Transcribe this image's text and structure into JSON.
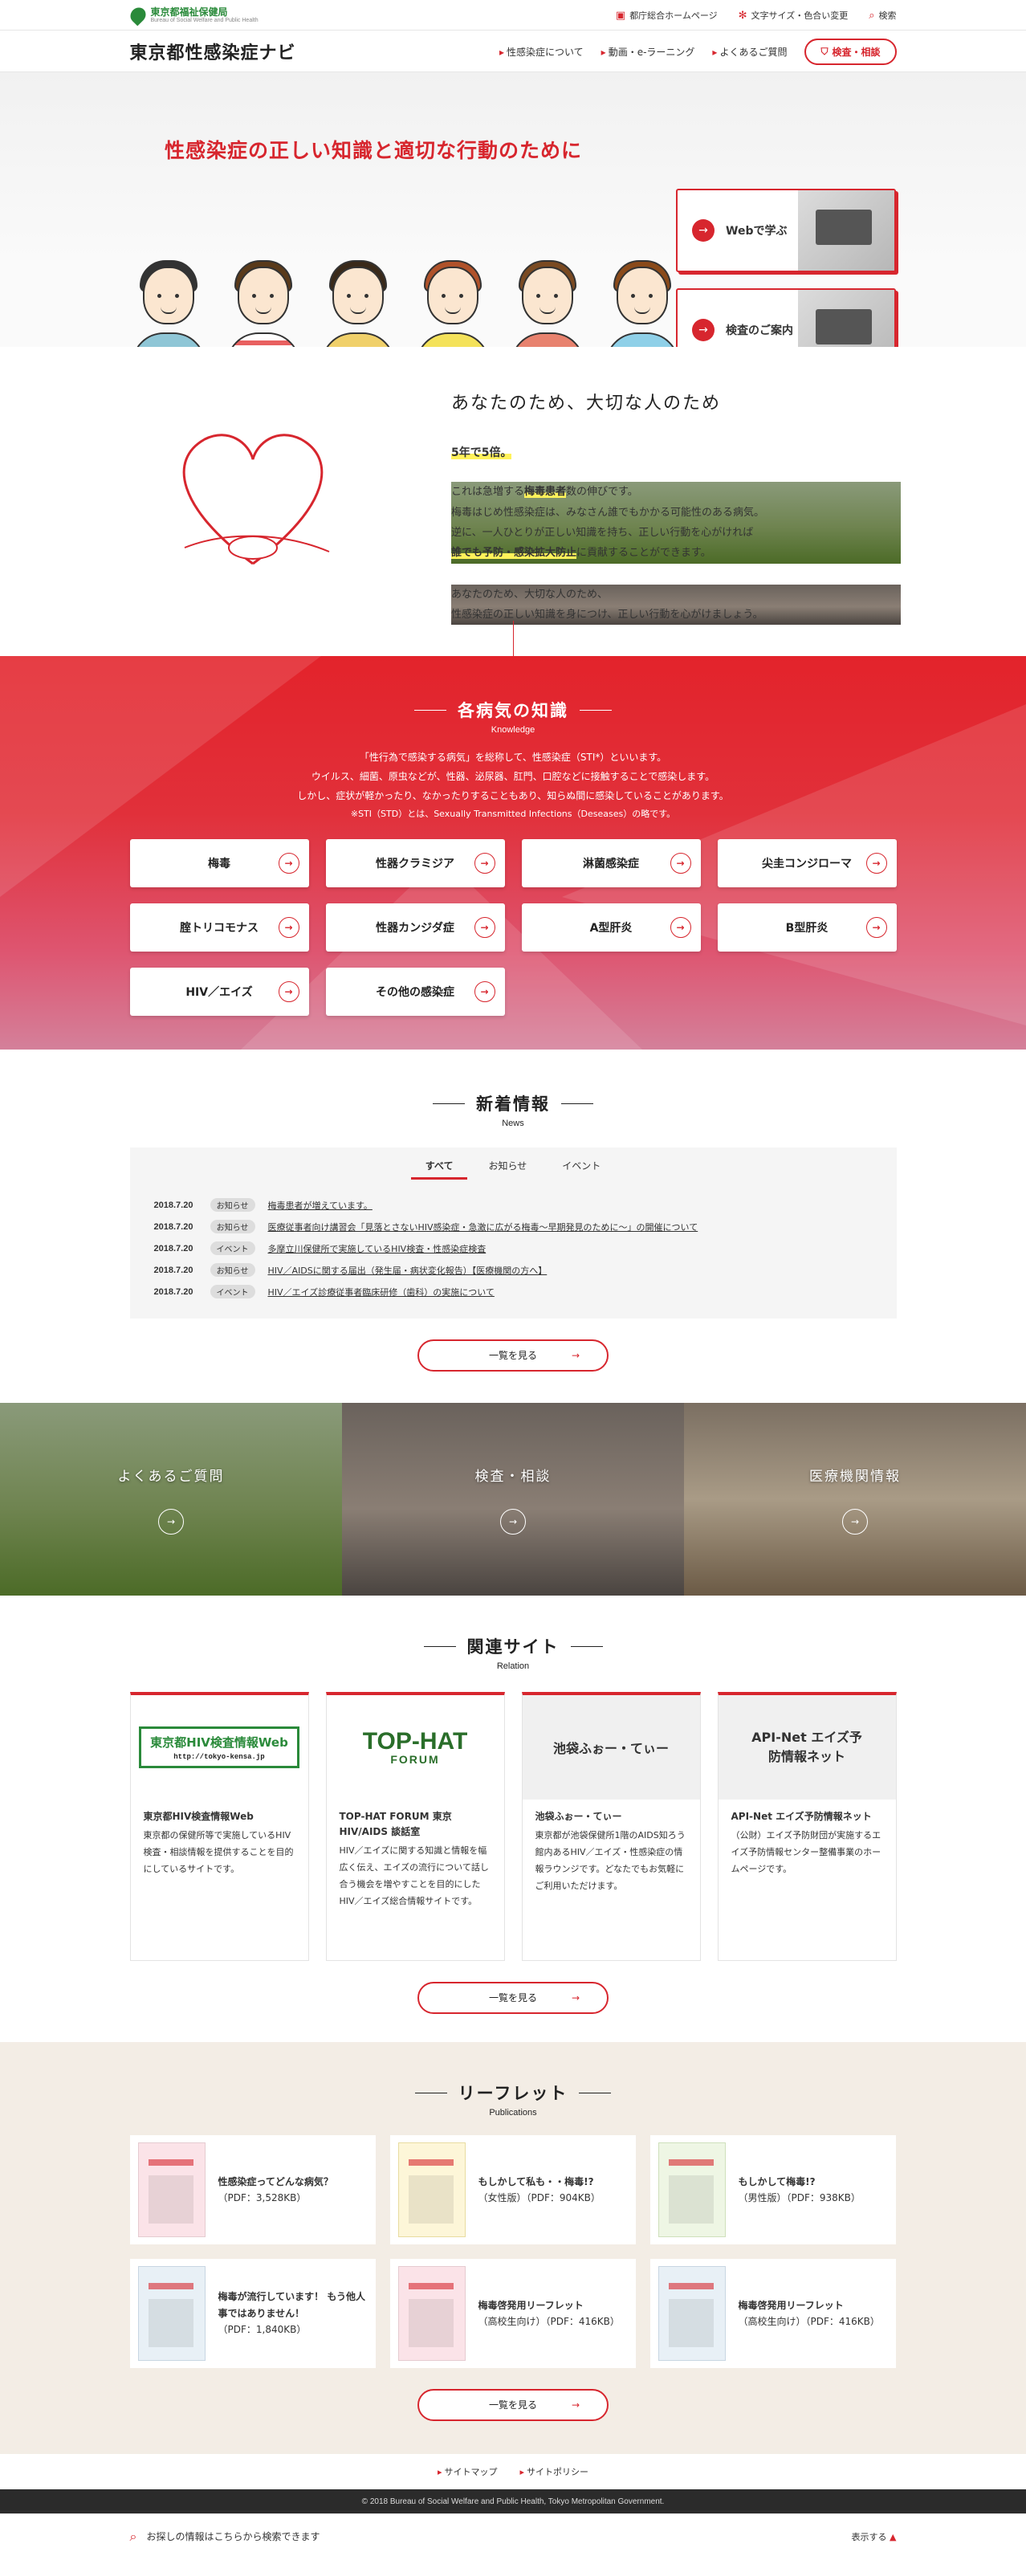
{
  "util": {
    "bureau_jp": "東京都福祉保健局",
    "bureau_en": "Bureau of Social Welfare and Public Health",
    "links": [
      {
        "icon": "monitor-icon",
        "label": "都庁総合ホームページ"
      },
      {
        "icon": "gear-icon",
        "label": "文字サイズ・色合い変更"
      },
      {
        "icon": "search-icon",
        "label": "検索"
      }
    ]
  },
  "header": {
    "title": "東京都性感染症ナビ",
    "nav": [
      "性感染症について",
      "動画・e-ラーニング",
      "よくあるご質問"
    ],
    "kensa_button": "検査・相談"
  },
  "hero": {
    "title": "性感染症の正しい知識と適切な行動のために",
    "buttons": [
      "Webで学ぶ",
      "検査のご案内"
    ]
  },
  "intro": {
    "heading": "あなたのため、大切な人のため",
    "emphasis": "5年で5倍。",
    "p1_a": "これは急増する",
    "p1_hl": "梅毒患者",
    "p1_b": "数の伸びです。",
    "p2": "梅毒はじめ性感染症は、みなさん誰でもかかる可能性のある病気。",
    "p3": "逆に、一人ひとりが正しい知識を持ち、正しい行動を心がければ",
    "p4_hl": "誰でも予防・感染拡大防止",
    "p4_b": "に貢献することができます。",
    "p5": "あなたのため、大切な人のため、",
    "p6": "性感染症の正しい知識を身につけ、正しい行動を心がけましょう。"
  },
  "knowledge": {
    "title": "各病気の知識",
    "subtitle": "Knowledge",
    "desc1": "「性行為で感染する病気」を総称して、性感染症（STI*）といいます。",
    "desc2": "ウイルス、細菌、原虫などが、性器、泌尿器、肛門、口腔などに接触することで感染します。",
    "desc3": "しかし、症状が軽かったり、なかったりすることもあり、知らぬ間に感染していることがあります。",
    "note": "※STI（STD）とは、Sexually Transmitted Infections（Deseases）の略です。",
    "diseases": [
      "梅毒",
      "性器クラミジア",
      "淋菌感染症",
      "尖圭コンジローマ",
      "腟トリコモナス",
      "性器カンジダ症",
      "A型肝炎",
      "B型肝炎",
      "HIV／エイズ",
      "その他の感染症"
    ]
  },
  "news": {
    "title": "新着情報",
    "subtitle": "News",
    "tabs": [
      "すべて",
      "お知らせ",
      "イベント"
    ],
    "items": [
      {
        "date": "2018.7.20",
        "cat": "お知らせ",
        "text": "梅毒患者が増えています。"
      },
      {
        "date": "2018.7.20",
        "cat": "お知らせ",
        "text": "医療従事者向け講習会「見落とさないHIV感染症・急激に広がる梅毒～早期発見のために～」の開催について"
      },
      {
        "date": "2018.7.20",
        "cat": "イベント",
        "text": "多摩立川保健所で実施しているHIV検査・性感染症検査"
      },
      {
        "date": "2018.7.20",
        "cat": "お知らせ",
        "text": "HIV／AIDSに関する届出（発生届・病状変化報告）【医療機関の方へ】"
      },
      {
        "date": "2018.7.20",
        "cat": "イベント",
        "text": "HIV／エイズ診療従事者臨床研修（歯科）の実施について"
      }
    ],
    "more": "一覧を見る"
  },
  "photos": [
    "よくあるご質問",
    "検査・相談",
    "医療機関情報"
  ],
  "relation": {
    "title": "関連サイト",
    "subtitle": "Relation",
    "cards": [
      {
        "logo": "東京都HIV検査情報Web",
        "logo_url": "http://tokyo-kensa.jp",
        "title": "東京都HIV検査情報Web",
        "desc": "東京都の保健所等で実施しているHIV検査・相談情報を提供することを目的にしているサイトです。"
      },
      {
        "logo": "TOP-HAT",
        "logo_sub": "FORUM",
        "title": "TOP-HAT FORUM 東京HIV/AIDS 談話室",
        "desc": "HIV／エイズに関する知識と情報を幅広く伝え、エイズの流行について話し合う機会を増やすことを目的にしたHIV／エイズ総合情報サイトです。"
      },
      {
        "logo": "池袋ふぉー・てぃー",
        "title": "池袋ふぉー・てぃー",
        "desc": "東京都が池袋保健所1階のAIDS知ろう館内あるHIV／エイズ・性感染症の情報ラウンジです。どなたでもお気軽にご利用いただけます。"
      },
      {
        "logo": "API-Net エイズ予防情報ネット",
        "title": "API-Net エイズ予防情報ネット",
        "desc": "（公財）エイズ予防財団が実施するエイズ予防情報センター整備事業のホームページです。"
      }
    ],
    "more": "一覧を見る"
  },
  "leaflets": {
    "title": "リーフレット",
    "subtitle": "Publications",
    "items": [
      {
        "title": "性感染症ってどんな病気？",
        "meta": "（PDF：3,528KB）"
      },
      {
        "title": "もしかして私も・・梅毒!?",
        "meta": "（女性版）（PDF：904KB）"
      },
      {
        "title": "もしかして梅毒!?",
        "meta": "（男性版）（PDF：938KB）"
      },
      {
        "title": "梅毒が流行しています！ もう他人事ではありません！",
        "meta": "（PDF：1,840KB）"
      },
      {
        "title": "梅毒啓発用リーフレット",
        "meta": "（高校生向け）（PDF：416KB）"
      },
      {
        "title": "梅毒啓発用リーフレット",
        "meta": "（高校生向け）（PDF：416KB）"
      }
    ],
    "more": "一覧を見る"
  },
  "footer": {
    "links": [
      "サイトマップ",
      "サイトポリシー"
    ],
    "copyright": "© 2018 Bureau of Social Welfare and Public Health, Tokyo Metropolitan Government.",
    "search_text": "お探しの情報はこちらから検索できます",
    "display": "表示する"
  }
}
